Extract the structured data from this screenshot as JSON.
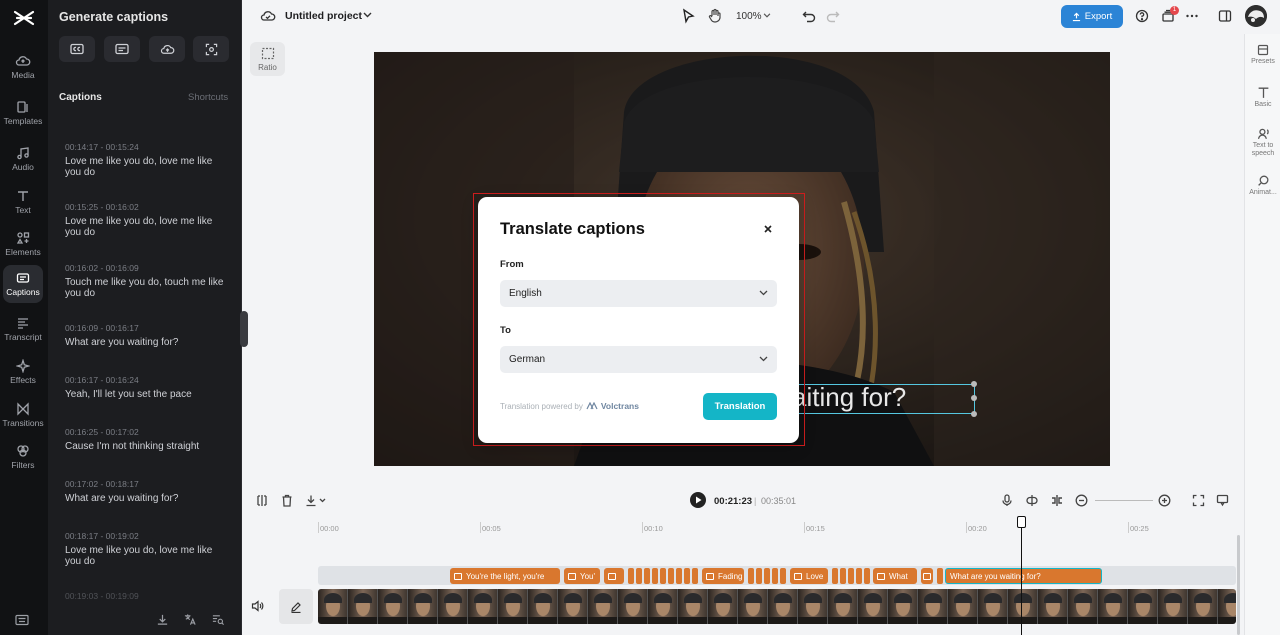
{
  "nav": {
    "items": [
      {
        "label": "Media",
        "icon": "cloud-icon"
      },
      {
        "label": "Templates",
        "icon": "template-icon"
      },
      {
        "label": "Audio",
        "icon": "music-icon"
      },
      {
        "label": "Text",
        "icon": "text-icon"
      },
      {
        "label": "Elements",
        "icon": "elements-icon"
      },
      {
        "label": "Captions",
        "icon": "captions-icon",
        "active": true
      },
      {
        "label": "Transcript",
        "icon": "transcript-icon"
      },
      {
        "label": "Effects",
        "icon": "effects-icon"
      },
      {
        "label": "Transitions",
        "icon": "transitions-icon"
      },
      {
        "label": "Filters",
        "icon": "filters-icon"
      }
    ]
  },
  "side_panel": {
    "title": "Generate captions",
    "captions_heading": "Captions",
    "shortcuts_link": "Shortcuts",
    "captions": [
      {
        "time": "00:14:17 - 00:15:24",
        "text": "Love me like you do, love me like you do"
      },
      {
        "time": "00:15:25 - 00:16:02",
        "text": "Love me like you do, love me like you do"
      },
      {
        "time": "00:16:02 - 00:16:09",
        "text": "Touch me like you do, touch me like you do"
      },
      {
        "time": "00:16:09 - 00:16:17",
        "text": "What are you waiting for?"
      },
      {
        "time": "00:16:17 - 00:16:24",
        "text": "Yeah, I'll let you set the pace"
      },
      {
        "time": "00:16:25 - 00:17:02",
        "text": "Cause I'm not thinking straight"
      },
      {
        "time": "00:17:02 - 00:18:17",
        "text": "What are you waiting for?"
      },
      {
        "time": "00:18:17 - 00:19:02",
        "text": "Love me like you do, love me like you do"
      },
      {
        "time": "00:19:03 - 00:19:09",
        "text": ""
      }
    ]
  },
  "topbar": {
    "project_name": "Untitled project",
    "zoom": "100%",
    "export_label": "Export",
    "notification_count": "1"
  },
  "canvas": {
    "ratio_label": "Ratio",
    "overlay_caption": "aiting for?"
  },
  "right_panel": {
    "items": [
      {
        "label": "Presets",
        "icon": "presets-icon"
      },
      {
        "label": "Basic",
        "icon": "basic-text-icon"
      },
      {
        "label": "Text to speech",
        "icon": "speech-icon"
      },
      {
        "label": "Animat...",
        "icon": "animation-icon"
      }
    ]
  },
  "dialog": {
    "title": "Translate captions",
    "from_label": "From",
    "from_value": "English",
    "to_label": "To",
    "to_value": "German",
    "powered_by": "Translation powered by",
    "vendor": "Volctrans",
    "translate_button": "Translation"
  },
  "timeline": {
    "current_time": "00:21:23",
    "separator": "|",
    "total_time": "00:35:01",
    "ruler": [
      "00:00",
      "00:05",
      "00:10",
      "00:15",
      "00:20",
      "00:25"
    ],
    "clips": [
      {
        "text": "You're the light, you're"
      },
      {
        "text": "You'"
      },
      {
        "text": ""
      },
      {
        "text": "Fading"
      },
      {
        "text": "Love"
      },
      {
        "text": "What"
      },
      {
        "text": ""
      },
      {
        "text": "What are you waiting for?"
      }
    ]
  },
  "colors": {
    "accent": "#14b5c7",
    "export": "#2b84d6",
    "clip": "#d9772e",
    "focus": "#d01e1e"
  }
}
